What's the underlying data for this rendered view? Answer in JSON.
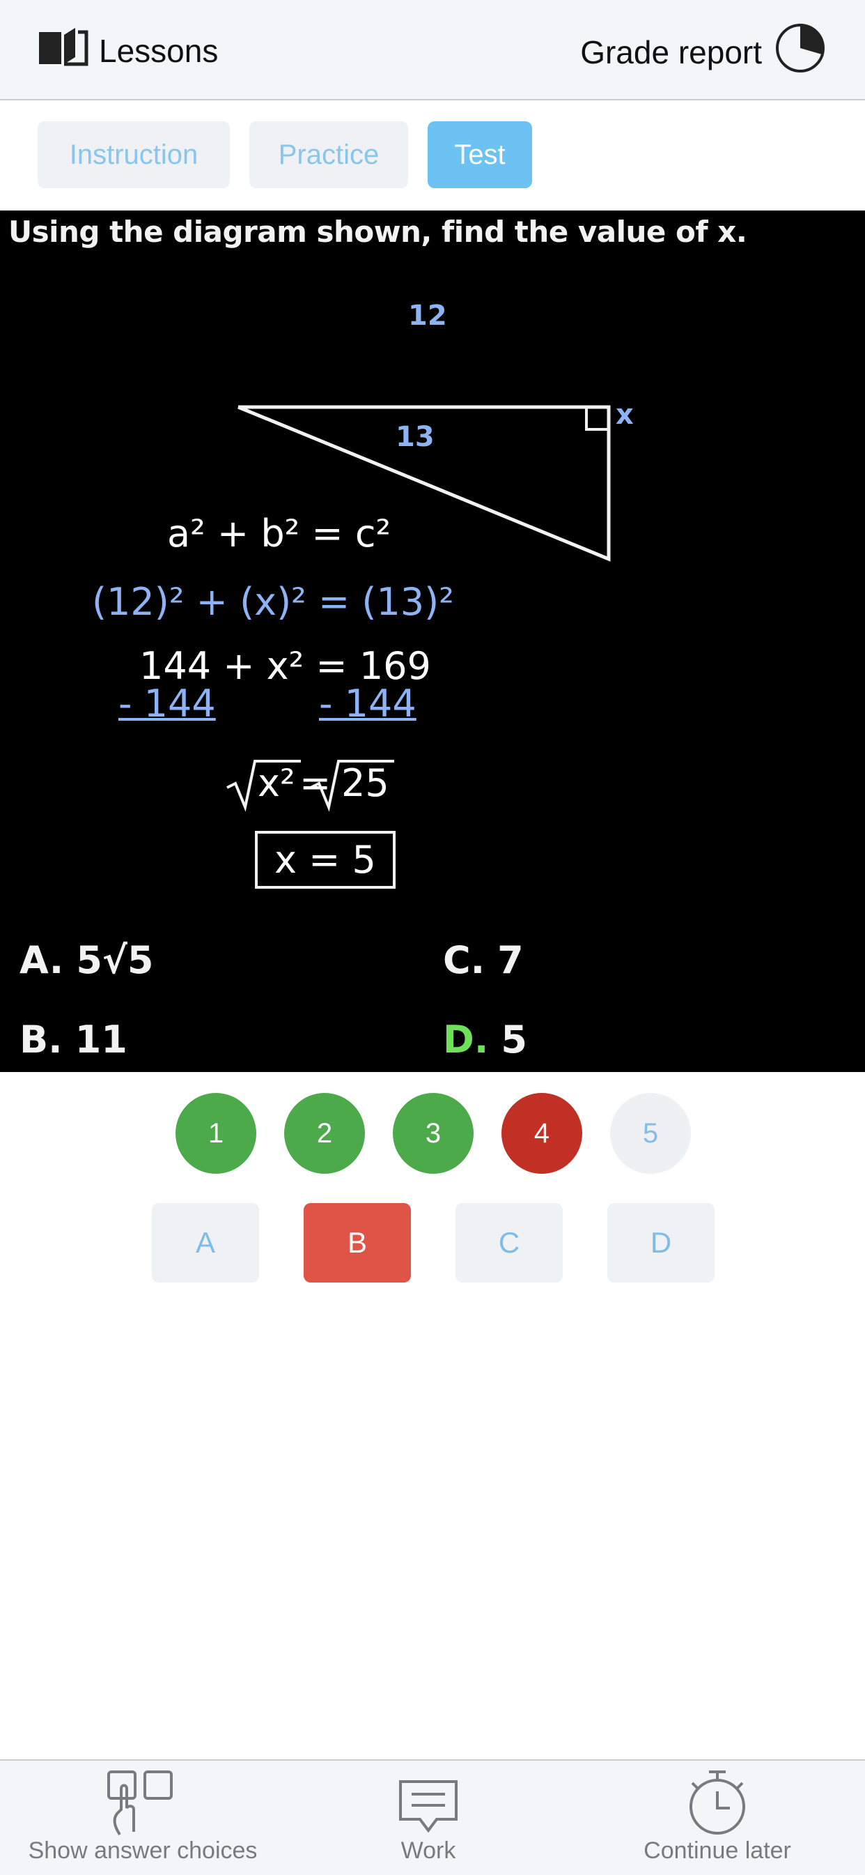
{
  "header": {
    "lessons_label": "Lessons",
    "grade_report_label": "Grade report"
  },
  "tabs": [
    {
      "label": "Instruction",
      "active": false
    },
    {
      "label": "Practice",
      "active": false
    },
    {
      "label": "Test",
      "active": true
    }
  ],
  "video": {
    "question": "Using the diagram shown, find the value of x.",
    "diagram": {
      "top_label": "12",
      "hypotenuse_label": "13",
      "side_label": "x"
    },
    "work": {
      "line1": "a² + b² = c²",
      "line2": "(12)² + (x)² = (13)²",
      "line3": "144 + x² = 169",
      "subtract_left": "- 144",
      "subtract_right": "- 144",
      "line4_left": "x²",
      "line4_right": "25",
      "result": "x = 5"
    },
    "answers": {
      "a": {
        "letter": "A.",
        "value": "5√5"
      },
      "b": {
        "letter": "B.",
        "value": "11"
      },
      "c": {
        "letter": "C.",
        "value": "7"
      },
      "d": {
        "letter": "D.",
        "value": "5"
      }
    }
  },
  "question_numbers": [
    {
      "label": "1",
      "status": "correct"
    },
    {
      "label": "2",
      "status": "correct"
    },
    {
      "label": "3",
      "status": "correct"
    },
    {
      "label": "4",
      "status": "incorrect"
    },
    {
      "label": "5",
      "status": "unanswered"
    }
  ],
  "answer_choices": [
    {
      "label": "A",
      "selected": false
    },
    {
      "label": "B",
      "selected": true
    },
    {
      "label": "C",
      "selected": false
    },
    {
      "label": "D",
      "selected": false
    }
  ],
  "bottom_bar": {
    "show_answer_choices": "Show answer choices",
    "work": "Work",
    "continue_later": "Continue later"
  },
  "colors": {
    "tab_active": "#6cc2f2",
    "correct": "#4caa4b",
    "incorrect": "#c03024",
    "selected_choice": "#de5446"
  }
}
